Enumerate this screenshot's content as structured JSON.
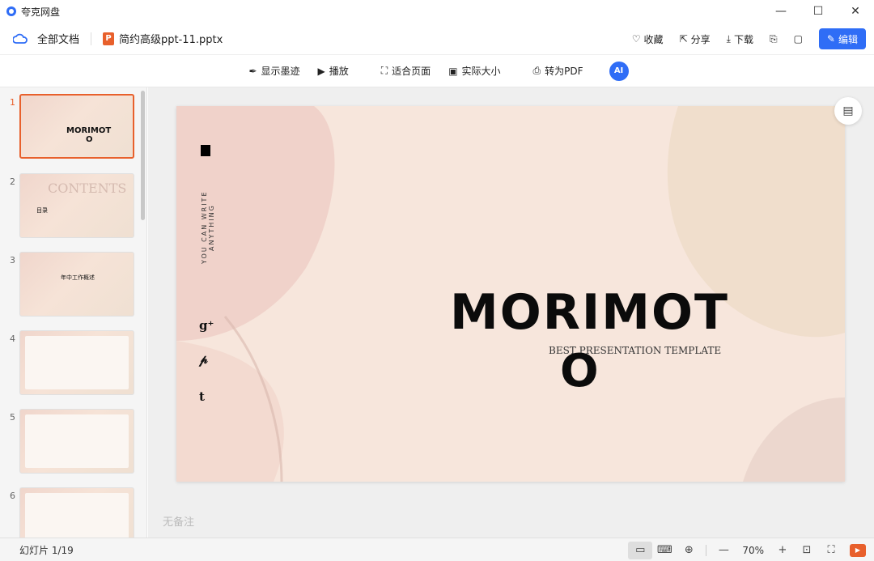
{
  "app": {
    "title": "夸克网盘"
  },
  "window_controls": {
    "minimize": "—",
    "maximize": "☐",
    "close": "✕"
  },
  "nav": {
    "all_docs": "全部文档",
    "file_name": "简约高级ppt-11.pptx",
    "file_badge": "P"
  },
  "actions": {
    "favorite": "收藏",
    "share": "分享",
    "download": "下载",
    "edit": "编辑"
  },
  "view_toolbar": {
    "show_ink": "显示墨迹",
    "play": "播放",
    "fit_page": "适合页面",
    "actual_size": "实际大小",
    "to_pdf": "转为PDF",
    "ai_label": "AI"
  },
  "thumbnails": [
    {
      "num": "1",
      "caption": "MORIMOT",
      "caption2": "O"
    },
    {
      "num": "2",
      "caption": "CONTENTS",
      "label": "目录"
    },
    {
      "num": "3",
      "caption": "年中工作概述"
    },
    {
      "num": "4"
    },
    {
      "num": "5"
    },
    {
      "num": "6"
    }
  ],
  "slide": {
    "vertical_text": "YOU CAN WRITE ANYTHING",
    "title_line1": "MORIMOT",
    "title_line2": "O",
    "subtitle": "BEST PRESENTATION TEMPLATE",
    "social": [
      "g⁺",
      "𝓅",
      "t"
    ]
  },
  "notes_placeholder": "无备注",
  "status": {
    "slide_count": "幻灯片 1/19",
    "zoom": "70%"
  },
  "colors": {
    "accent": "#2f6df6",
    "brand_orange": "#e8602c",
    "slide_bg": "#f7e6dc"
  }
}
